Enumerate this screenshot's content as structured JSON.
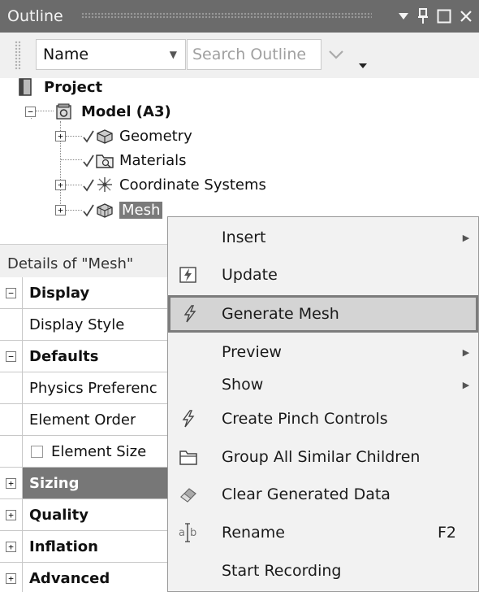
{
  "outline": {
    "title": "Outline",
    "window_buttons": [
      "dropdown",
      "pin",
      "maximize",
      "close"
    ]
  },
  "search": {
    "filter_value": "Name",
    "placeholder": "Search Outline"
  },
  "tree": {
    "project": "Project",
    "model": "Model (A3)",
    "geometry": "Geometry",
    "materials": "Materials",
    "coordinate_systems": "Coordinate Systems",
    "mesh": "Mesh"
  },
  "details": {
    "title": "Details of \"Mesh\"",
    "rows": {
      "display": "Display",
      "display_style": "Display Style",
      "defaults": "Defaults",
      "physics_preference": "Physics Preferenc",
      "element_order": "Element Order",
      "element_size": "Element Size",
      "sizing": "Sizing",
      "quality": "Quality",
      "inflation": "Inflation",
      "advanced": "Advanced"
    }
  },
  "context_menu": {
    "items": {
      "insert": "Insert",
      "update": "Update",
      "generate_mesh": "Generate Mesh",
      "preview": "Preview",
      "show": "Show",
      "create_pinch_controls": "Create Pinch Controls",
      "group_all_similar_children": "Group All Similar Children",
      "clear_generated_data": "Clear Generated Data",
      "rename": "Rename",
      "rename_shortcut": "F2",
      "start_recording": "Start Recording"
    },
    "highlighted": "generate_mesh"
  },
  "colors": {
    "title_bar": "#6b6b6b",
    "selection": "#7a7a7a",
    "menu_bg": "#f2f2f2",
    "menu_highlight": "#d4d4d4"
  }
}
